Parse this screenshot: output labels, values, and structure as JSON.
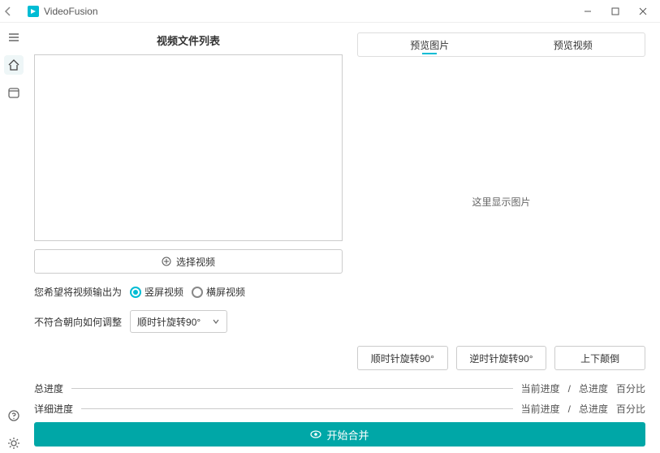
{
  "titlebar": {
    "app_name": "VideoFusion"
  },
  "left_panel": {
    "list_title": "视频文件列表",
    "select_button": "选择视频",
    "output_label": "您希望将视频输出为",
    "radio_portrait": "竖屏视频",
    "radio_landscape": "横屏视频",
    "adjust_label": "不符合朝向如何调整",
    "adjust_value": "顺时针旋转90°"
  },
  "right_panel": {
    "tab_image": "预览图片",
    "tab_video": "预览视频",
    "placeholder": "这里显示图片",
    "btn_cw": "顺时针旋转90°",
    "btn_ccw": "逆时针旋转90°",
    "btn_flip": "上下颠倒"
  },
  "progress": {
    "overall_label": "总进度",
    "detail_label": "详细进度",
    "current": "当前进度",
    "sep": "/",
    "total": "总进度",
    "percent": "百分比"
  },
  "start_button": "开始合并"
}
